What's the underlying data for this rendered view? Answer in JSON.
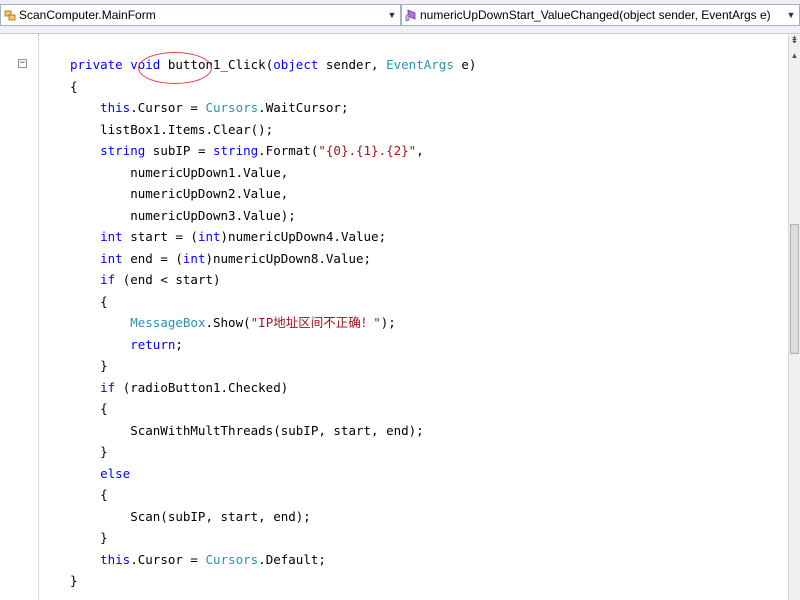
{
  "navbar": {
    "class_combo": "ScanComputer.MainForm",
    "class_icon": "class-icon",
    "member_combo": "numericUpDownStart_ValueChanged(object sender, EventArgs e)",
    "member_icon": "method-icon",
    "dropdown_glyph": "▼"
  },
  "editor": {
    "collapse_glyph": "−",
    "lines": [
      [
        {
          "t": "private void ",
          "c": "kw"
        },
        {
          "t": "button1_Click",
          "c": "pl"
        },
        {
          "t": "(",
          "c": "pl"
        },
        {
          "t": "object",
          "c": "kw"
        },
        {
          "t": " sender, ",
          "c": "pl"
        },
        {
          "t": "EventArgs",
          "c": "ty"
        },
        {
          "t": " e)",
          "c": "pl"
        }
      ],
      [
        {
          "t": "{",
          "c": "pl"
        }
      ],
      [
        {
          "t": "    ",
          "c": "pl"
        },
        {
          "t": "this",
          "c": "kw"
        },
        {
          "t": ".Cursor = ",
          "c": "pl"
        },
        {
          "t": "Cursors",
          "c": "ty"
        },
        {
          "t": ".WaitCursor;",
          "c": "pl"
        }
      ],
      [
        {
          "t": "    listBox1.Items.Clear();",
          "c": "pl"
        }
      ],
      [
        {
          "t": "    ",
          "c": "pl"
        },
        {
          "t": "string",
          "c": "kw"
        },
        {
          "t": " subIP = ",
          "c": "pl"
        },
        {
          "t": "string",
          "c": "kw"
        },
        {
          "t": ".Format(",
          "c": "pl"
        },
        {
          "t": "\"{0}.{1}.{2}\"",
          "c": "st"
        },
        {
          "t": ",",
          "c": "pl"
        }
      ],
      [
        {
          "t": "        numericUpDown1.Value,",
          "c": "pl"
        }
      ],
      [
        {
          "t": "        numericUpDown2.Value,",
          "c": "pl"
        }
      ],
      [
        {
          "t": "        numericUpDown3.Value);",
          "c": "pl"
        }
      ],
      [
        {
          "t": "    ",
          "c": "pl"
        },
        {
          "t": "int",
          "c": "kw"
        },
        {
          "t": " start = (",
          "c": "pl"
        },
        {
          "t": "int",
          "c": "kw"
        },
        {
          "t": ")numericUpDown4.Value;",
          "c": "pl"
        }
      ],
      [
        {
          "t": "    ",
          "c": "pl"
        },
        {
          "t": "int",
          "c": "kw"
        },
        {
          "t": " end = (",
          "c": "pl"
        },
        {
          "t": "int",
          "c": "kw"
        },
        {
          "t": ")numericUpDown8.Value;",
          "c": "pl"
        }
      ],
      [
        {
          "t": "    ",
          "c": "pl"
        },
        {
          "t": "if",
          "c": "kw"
        },
        {
          "t": " (end < start)",
          "c": "pl"
        }
      ],
      [
        {
          "t": "    {",
          "c": "pl"
        }
      ],
      [
        {
          "t": "        ",
          "c": "pl"
        },
        {
          "t": "MessageBox",
          "c": "ty"
        },
        {
          "t": ".Show(",
          "c": "pl"
        },
        {
          "t": "\"IP地址区间不正确！\"",
          "c": "st"
        },
        {
          "t": ");",
          "c": "pl"
        }
      ],
      [
        {
          "t": "        ",
          "c": "pl"
        },
        {
          "t": "return",
          "c": "kw"
        },
        {
          "t": ";",
          "c": "pl"
        }
      ],
      [
        {
          "t": "    }",
          "c": "pl"
        }
      ],
      [
        {
          "t": "    ",
          "c": "pl"
        },
        {
          "t": "if",
          "c": "kw"
        },
        {
          "t": " (radioButton1.Checked)",
          "c": "pl"
        }
      ],
      [
        {
          "t": "    {",
          "c": "pl"
        }
      ],
      [
        {
          "t": "        ScanWithMultThreads(subIP, start, end);",
          "c": "pl"
        }
      ],
      [
        {
          "t": "    }",
          "c": "pl"
        }
      ],
      [
        {
          "t": "    ",
          "c": "pl"
        },
        {
          "t": "else",
          "c": "kw"
        }
      ],
      [
        {
          "t": "    {",
          "c": "pl"
        }
      ],
      [
        {
          "t": "        Scan(subIP, start, end);",
          "c": "pl"
        }
      ],
      [
        {
          "t": "    }",
          "c": "pl"
        }
      ],
      [
        {
          "t": "    ",
          "c": "pl"
        },
        {
          "t": "this",
          "c": "kw"
        },
        {
          "t": ".Cursor = ",
          "c": "pl"
        },
        {
          "t": "Cursors",
          "c": "ty"
        },
        {
          "t": ".Default;",
          "c": "pl"
        }
      ],
      [
        {
          "t": "}",
          "c": "pl"
        }
      ]
    ]
  },
  "scrollbar": {
    "split_glyph": "⇟",
    "up_glyph": "▲"
  },
  "colors": {
    "keyword": "#0000ff",
    "type": "#2b91af",
    "string": "#a31515",
    "highlight": "#e04040"
  }
}
